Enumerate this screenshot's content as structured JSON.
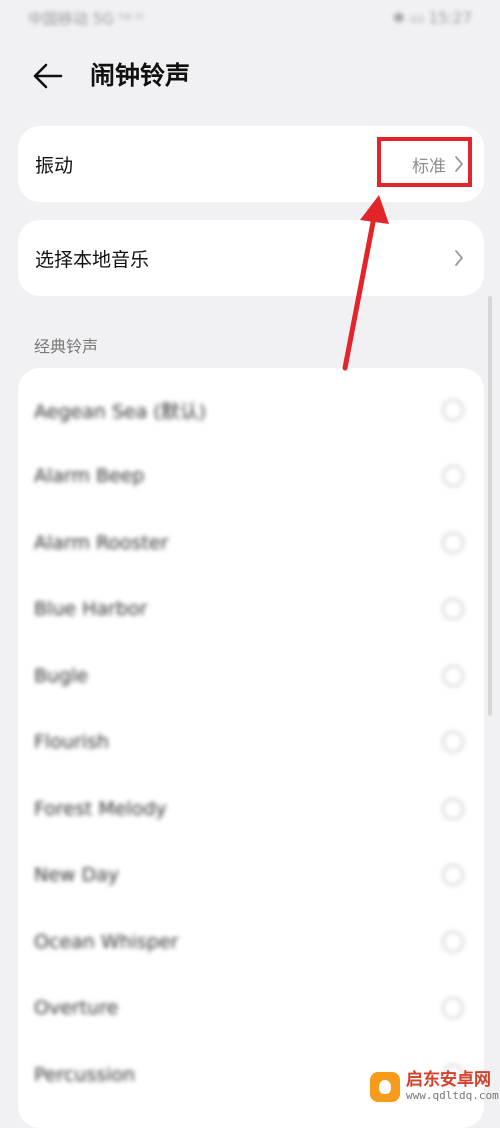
{
  "status_bar": {
    "left": "中国移动 5G ᵗᵃˡ ᵗˡ",
    "right": "✱ ▭ 15:27"
  },
  "header": {
    "title": "闹钟铃声"
  },
  "vibration": {
    "label": "振动",
    "value": "标准"
  },
  "local_music": {
    "label": "选择本地音乐"
  },
  "classic": {
    "section_title": "经典铃声",
    "items": [
      "Aegean Sea (默认)",
      "Alarm Beep",
      "Alarm Rooster",
      "Blue Harbor",
      "Bugle",
      "Flourish",
      "Forest Melody",
      "New Day",
      "Ocean Whisper",
      "Overture",
      "Percussion"
    ]
  },
  "annotation": {
    "color": "#e3242b"
  },
  "watermark": {
    "title": "启东安卓网",
    "url": "www.qdltdq.com"
  }
}
